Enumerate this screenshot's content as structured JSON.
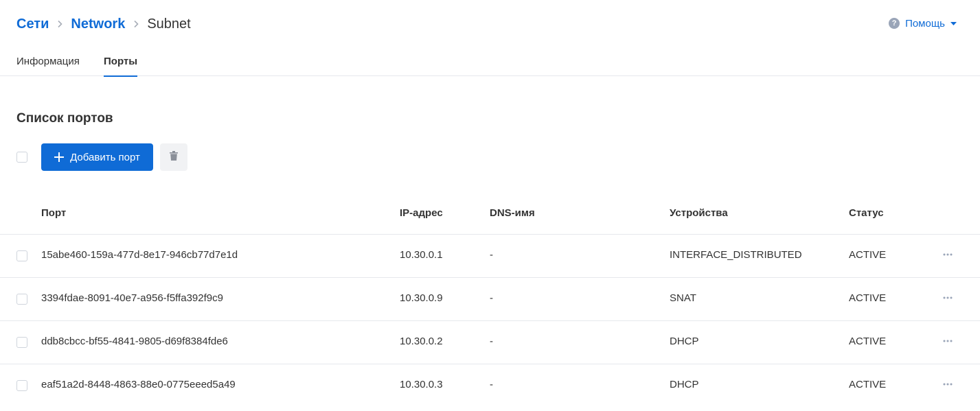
{
  "breadcrumb": {
    "items": [
      {
        "label": "Сети"
      },
      {
        "label": "Network"
      }
    ],
    "current": "Subnet"
  },
  "help": {
    "label": "Помощь",
    "icon": "question-circle-icon"
  },
  "tabs": [
    {
      "label": "Информация",
      "active": false
    },
    {
      "label": "Порты",
      "active": true
    }
  ],
  "section": {
    "title": "Список портов"
  },
  "toolbar": {
    "add_label": "Добавить порт",
    "delete_icon": "trash-icon"
  },
  "table": {
    "columns": [
      "Порт",
      "IP-адрес",
      "DNS-имя",
      "Устройства",
      "Статус"
    ],
    "rows": [
      {
        "port": "15abe460-159a-477d-8e17-946cb77d7e1d",
        "ip": "10.30.0.1",
        "dns": "-",
        "device": "INTERFACE_DISTRIBUTED",
        "status": "ACTIVE"
      },
      {
        "port": "3394fdae-8091-40e7-a956-f5ffa392f9c9",
        "ip": "10.30.0.9",
        "dns": "-",
        "device": "SNAT",
        "status": "ACTIVE"
      },
      {
        "port": "ddb8cbcc-bf55-4841-9805-d69f8384fde6",
        "ip": "10.30.0.2",
        "dns": "-",
        "device": "DHCP",
        "status": "ACTIVE"
      },
      {
        "port": "eaf51a2d-8448-4863-88e0-0775eeed5a49",
        "ip": "10.30.0.3",
        "dns": "-",
        "device": "DHCP",
        "status": "ACTIVE"
      }
    ]
  },
  "colors": {
    "accent": "#0f6bd6",
    "border": "#e6e8ec",
    "text": "#333333"
  }
}
